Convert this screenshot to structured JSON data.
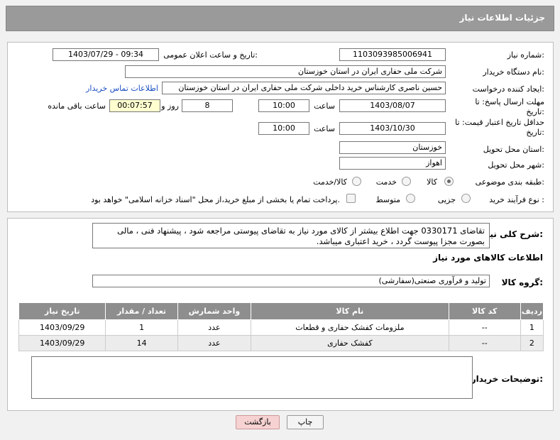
{
  "header": {
    "title": "جزئیات اطلاعات نیاز"
  },
  "form": {
    "need_number_label": "شماره نیاز:",
    "need_number": "1103093985006941",
    "announce_label": "تاریخ و ساعت اعلان عمومی:",
    "announce_value": "1403/07/29 - 09:34",
    "buyer_label": "نام دستگاه خریدار:",
    "buyer_value": "شرکت ملی حفاری ایران در استان خوزستان",
    "creator_label": "ایجاد کننده درخواست:",
    "creator_value": "حسین ناصری کارشناس خرید داخلی شرکت ملی حفاری ایران در استان خوزستان",
    "contact_link": "اطلاعات تماس خریدار",
    "deadline_label": "مهلت ارسال پاسخ: تا تاریخ:",
    "deadline_date": "1403/08/07",
    "time_label": "ساعت",
    "deadline_time": "10:00",
    "days_value": "8",
    "days_label": "روز و",
    "remaining_value": "00:07:57",
    "remaining_label": "ساعت باقی مانده",
    "validity_label": "حداقل تاریخ اعتبار قیمت: تا تاریخ:",
    "validity_date": "1403/10/30",
    "validity_time": "10:00",
    "province_label": "استان محل تحویل:",
    "province_value": "خوزستان",
    "city_label": "شهر محل تحویل:",
    "city_value": "اهواز",
    "category_label": "طبقه بندی موضوعی:",
    "category_options": [
      "کالا",
      "خدمت",
      "کالا/خدمت"
    ],
    "process_label": "نوع فرآیند خرید :",
    "process_options": [
      "جزیی",
      "متوسط"
    ],
    "payment_note": "پرداخت تمام یا بخشی از مبلغ خرید،از محل \"اسناد خزانه اسلامی\" خواهد بود."
  },
  "description": {
    "label": "شرح کلی نیاز:",
    "text": "تقاضای 0330171 جهت اطلاع بیشتر از کالای مورد نیاز به تقاضای پیوستی مراجعه شود ، پیشنهاد فنی ، مالی بصورت مجزا پیوست گردد ، خرید اعتباری میباشد."
  },
  "goods": {
    "section_title": "اطلاعات کالاهای مورد نیاز",
    "group_label": "گروه کالا:",
    "group_value": "تولید و فرآوری صنعتی(سفارشی)",
    "columns": [
      "ردیف",
      "کد کالا",
      "نام کالا",
      "واحد شمارش",
      "تعداد / مقدار",
      "تاریخ نیاز"
    ],
    "rows": [
      [
        "1",
        "--",
        "ملزومات کفشک حفاری و قطعات",
        "عدد",
        "1",
        "1403/09/29"
      ],
      [
        "2",
        "--",
        "کفشک حفاری",
        "عدد",
        "14",
        "1403/09/29"
      ]
    ]
  },
  "notes": {
    "label": "توضیحات خریدار:"
  },
  "buttons": {
    "print": "چاپ",
    "back": "بازگشت"
  }
}
